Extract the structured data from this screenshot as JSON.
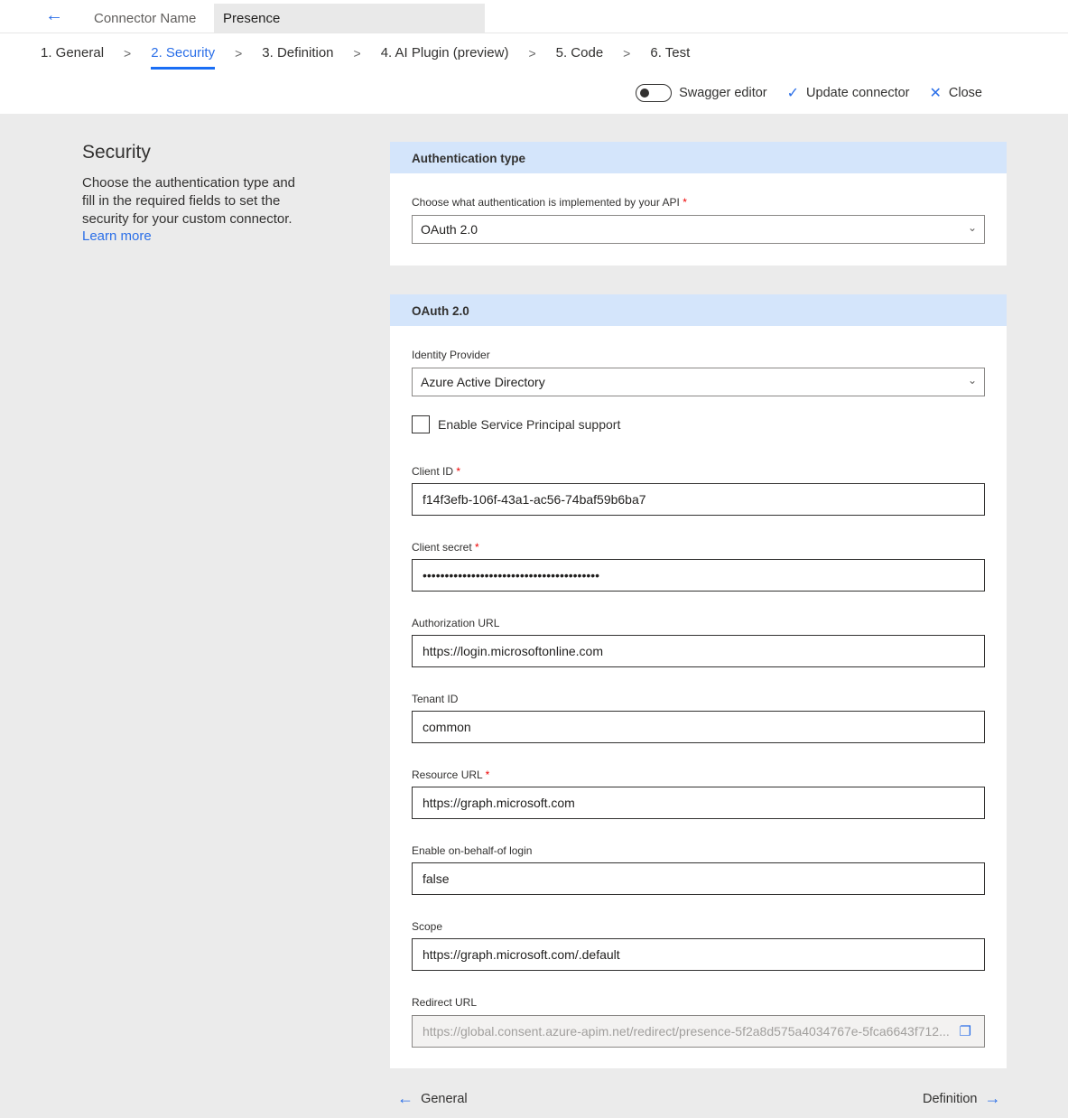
{
  "header": {
    "back_icon": "arrow-left-icon",
    "connector_name_label": "Connector Name",
    "connector_name_value": "Presence"
  },
  "steps": [
    {
      "label": "1. General"
    },
    {
      "label": "2. Security",
      "active": true
    },
    {
      "label": "3. Definition"
    },
    {
      "label": "4. AI Plugin (preview)"
    },
    {
      "label": "5. Code"
    },
    {
      "label": "6. Test"
    }
  ],
  "actions": {
    "swagger_label": "Swagger editor",
    "swagger_on": false,
    "update_label": "Update connector",
    "close_label": "Close"
  },
  "intro": {
    "title": "Security",
    "text": "Choose the authentication type and fill in the required fields to set the security for your custom connector.",
    "learn_more": "Learn more"
  },
  "auth_card": {
    "title": "Authentication type",
    "label": "Choose what authentication is implemented by your API",
    "value": "OAuth 2.0"
  },
  "oauth_card": {
    "title": "OAuth 2.0",
    "identity_label": "Identity Provider",
    "identity_value": "Azure Active Directory",
    "sp_label": "Enable Service Principal support",
    "sp_checked": false,
    "fields": [
      {
        "label": "Client ID",
        "required": true,
        "value": "f14f3efb-106f-43a1-ac56-74baf59b6ba7"
      },
      {
        "label": "Client secret",
        "required": true,
        "value": "••••••••••••••••••••••••••••••••••••••••"
      },
      {
        "label": "Authorization URL",
        "required": false,
        "value": "https://login.microsoftonline.com"
      },
      {
        "label": "Tenant ID",
        "required": false,
        "value": "common"
      },
      {
        "label": "Resource URL",
        "required": true,
        "value": "https://graph.microsoft.com"
      },
      {
        "label": "Enable on-behalf-of login",
        "required": false,
        "value": "false"
      },
      {
        "label": "Scope",
        "required": false,
        "value": "https://graph.microsoft.com/.default"
      }
    ],
    "redirect_label": "Redirect URL",
    "redirect_value": "https://global.consent.azure-apim.net/redirect/presence-5f2a8d575a4034767e-5fca6643f712..."
  },
  "footer": {
    "prev_label": "General",
    "next_label": "Definition"
  },
  "colors": {
    "accent": "#2b6fe8",
    "card_header": "#d4e5fb",
    "background": "#ebebeb"
  }
}
